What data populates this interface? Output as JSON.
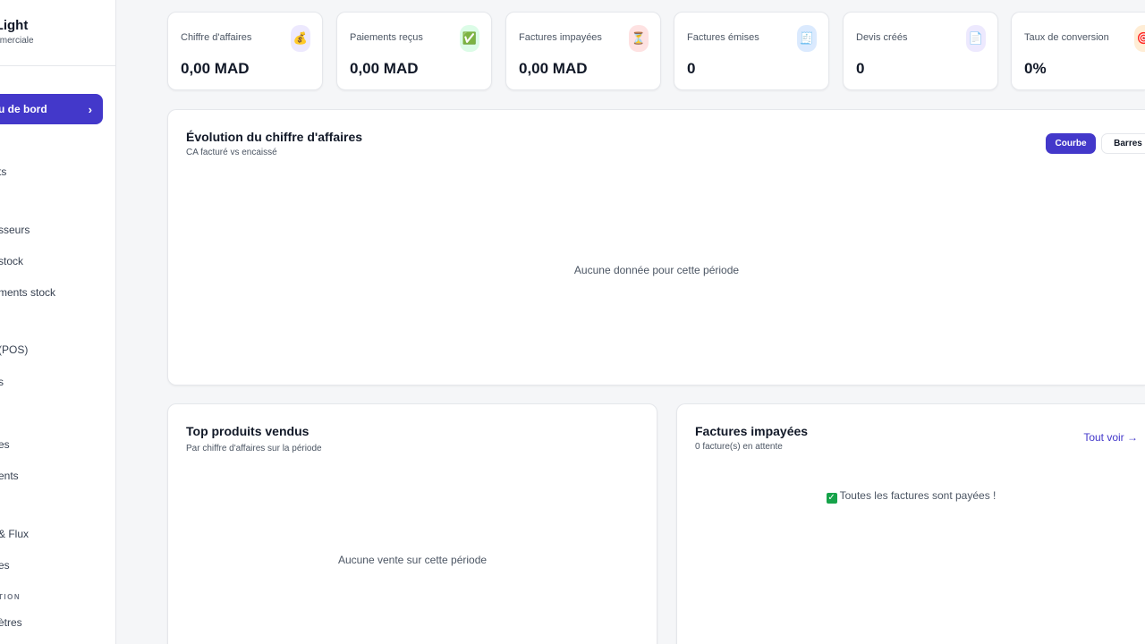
{
  "sidebar": {
    "brand_title": "ki Light",
    "brand_subtitle": "on commerciale",
    "active_item": "u de bord",
    "items": [
      "",
      "ts",
      "sseurs",
      " stock",
      "ments stock",
      " (POS)",
      "s",
      "es",
      "ents",
      " & Flux",
      "es",
      "ètres"
    ],
    "section_label": "TION"
  },
  "kpis": [
    {
      "label": "Chiffre d'affaires",
      "value": "0,00 MAD",
      "icon": "money-bag-icon",
      "icon_glyph": "💰",
      "icon_bg": "#ede9fe"
    },
    {
      "label": "Paiements reçus",
      "value": "0,00 MAD",
      "icon": "check-mark-icon",
      "icon_glyph": "✅",
      "icon_bg": "#dcfce7"
    },
    {
      "label": "Factures impayées",
      "value": "0,00 MAD",
      "icon": "hourglass-icon",
      "icon_glyph": "⏳",
      "icon_bg": "#fee2e2"
    },
    {
      "label": "Factures émises",
      "value": "0",
      "icon": "receipt-icon",
      "icon_glyph": "🧾",
      "icon_bg": "#dbeafe"
    },
    {
      "label": "Devis créés",
      "value": "0",
      "icon": "document-icon",
      "icon_glyph": "📄",
      "icon_bg": "#ede9fe"
    },
    {
      "label": "Taux de conversion",
      "value": "0%",
      "icon": "target-icon",
      "icon_glyph": "🎯",
      "icon_bg": "#ffedd5"
    }
  ],
  "revenue_chart": {
    "title": "Évolution du chiffre d'affaires",
    "subtitle": "CA facturé vs encaissé",
    "toggle_curve": "Courbe",
    "toggle_bars": "Barres",
    "empty_message": "Aucune donnée pour cette période"
  },
  "top_products": {
    "title": "Top produits vendus",
    "subtitle": "Par chiffre d'affaires sur la période",
    "empty_message": "Aucune vente sur cette période"
  },
  "unpaid_invoices": {
    "title": "Factures impayées",
    "subtitle": "0 facture(s) en attente",
    "view_all": "Tout voir →",
    "empty_message": "Toutes les factures sont payées !"
  },
  "colors": {
    "accent": "#4338ca",
    "success": "#16a34a"
  }
}
